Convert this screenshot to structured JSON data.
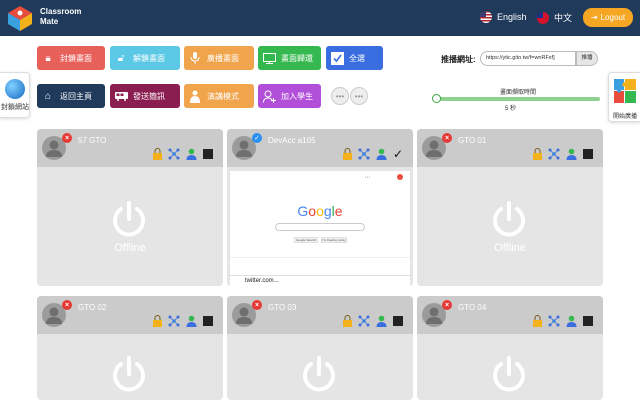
{
  "header": {
    "brand_line1": "Classroom",
    "brand_line2": "Mate",
    "lang_en": "English",
    "lang_zh": "中文",
    "logout": "Logout"
  },
  "sidetab": {
    "label": "封鎖網站"
  },
  "toolbar_row1": [
    {
      "label": "封鎖畫面",
      "color": "#e8605a",
      "icon": "lock-icon"
    },
    {
      "label": "解鎖畫面",
      "color": "#5bc8e5",
      "icon": "unlock-icon"
    },
    {
      "label": "廣播畫面",
      "color": "#f0a44b",
      "icon": "microphone-icon"
    },
    {
      "label": "畫面歸還",
      "color": "#34b84f",
      "icon": "monitor-icon"
    },
    {
      "label": "全選",
      "color": "#3a6ee0",
      "icon": "checkbox-icon"
    }
  ],
  "toolbar_row2": [
    {
      "label": "返回主頁",
      "color": "#1f3a5a",
      "icon": "home-icon"
    },
    {
      "label": "發送簡訊",
      "color": "#8b1e50",
      "icon": "bus-icon"
    },
    {
      "label": "演講模式",
      "color": "#f0a44b",
      "icon": "presenter-icon"
    },
    {
      "label": "加入學生",
      "color": "#b24fd8",
      "icon": "add-user-icon"
    }
  ],
  "more_dots": "•••",
  "push": {
    "label": "推播網址:",
    "url_value": "https://ytic.gito.tw/f=wnRFsf]",
    "button": "推播"
  },
  "frequency": {
    "label": "畫面擷取時間",
    "value": "5 秒",
    "slider_fraction": 0.0
  },
  "broadcast_tab": {
    "label": "開始廣播"
  },
  "students": [
    {
      "name": "57 GTO",
      "online": false,
      "status_symbol": "×",
      "offline_text": "Offline"
    },
    {
      "name": "DevAcc a105",
      "online": true,
      "status_symbol": "✓",
      "offline_text": ""
    },
    {
      "name": "GTO 01",
      "online": false,
      "status_symbol": "×",
      "offline_text": "Offline"
    },
    {
      "name": "GTO 02",
      "online": false,
      "status_symbol": "×",
      "offline_text": ""
    },
    {
      "name": "GTO 03",
      "online": false,
      "status_symbol": "×",
      "offline_text": ""
    },
    {
      "name": "GTO 04",
      "online": false,
      "status_symbol": "×",
      "offline_text": ""
    }
  ],
  "screenshot": {
    "google_letters": [
      "G",
      "o",
      "o",
      "g",
      "l",
      "e"
    ],
    "google_colors": [
      "#4285f4",
      "#ea4335",
      "#fbbc05",
      "#4285f4",
      "#34a853",
      "#ea4335"
    ],
    "btn1": "Google Search",
    "btn2": "I'm Feeling Lucky",
    "bottom_tab": "twitter.com..."
  }
}
